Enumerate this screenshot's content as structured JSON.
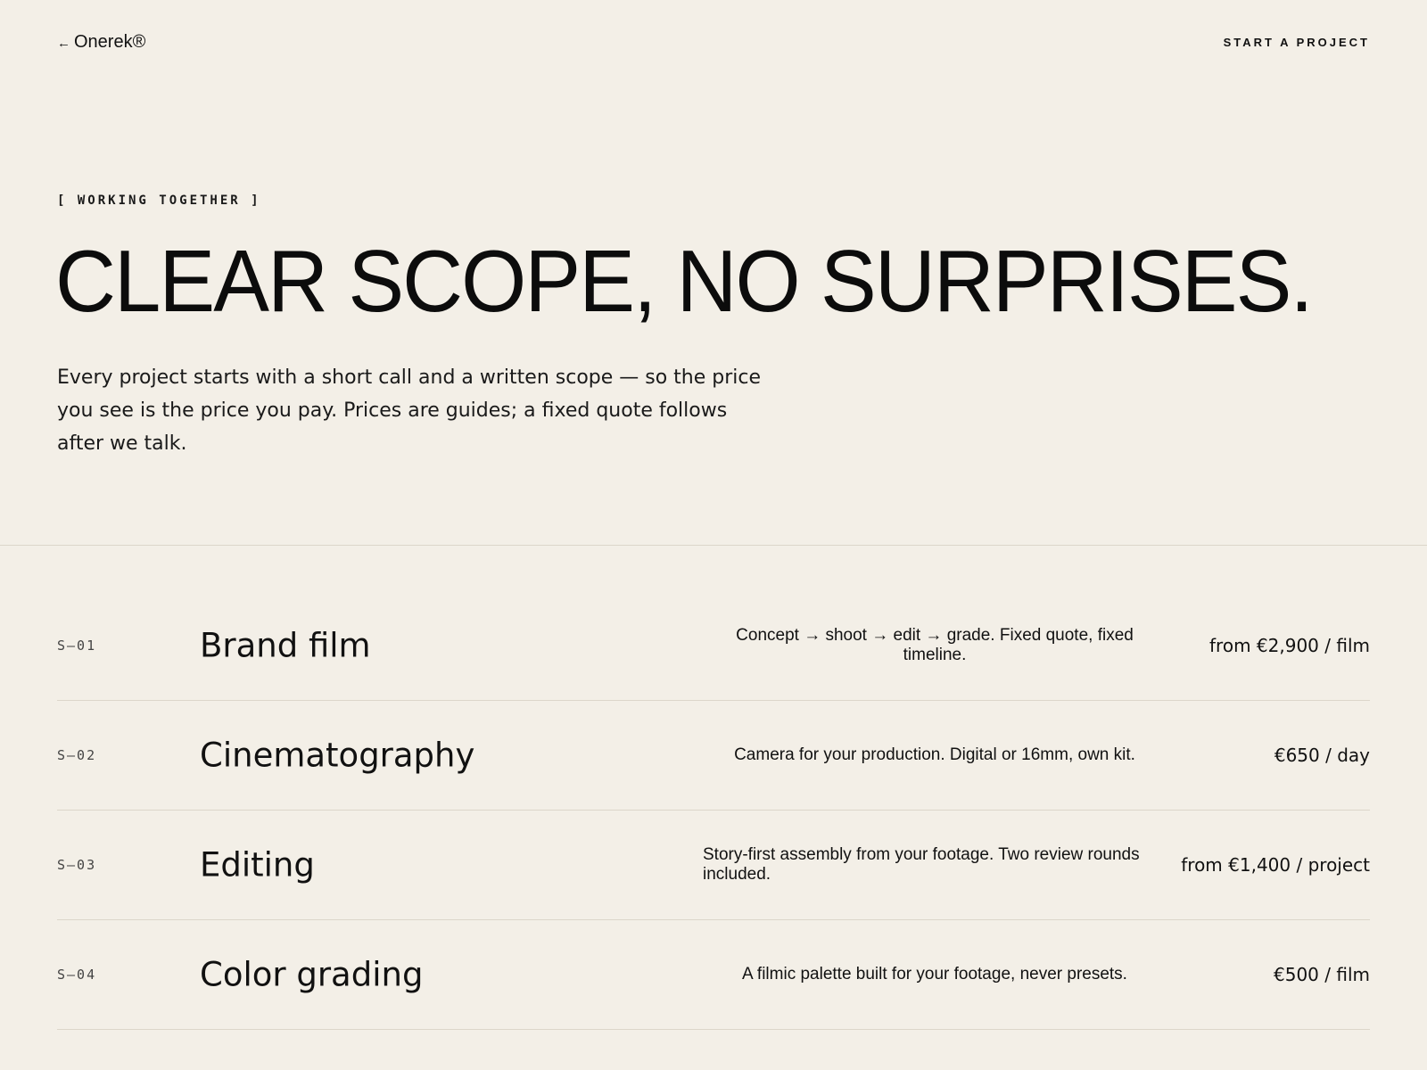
{
  "header": {
    "back_arrow": "←",
    "brand": "Onerek®",
    "cta": "START A PROJECT"
  },
  "hero": {
    "eyebrow": "[ WORKING TOGETHER ]",
    "headline": "CLEAR SCOPE, NO SURPRISES.",
    "intro": "Every project starts with a short call and a written scope — so the price you see is the price you pay. Prices are guides; a fixed quote follows after we talk."
  },
  "services": [
    {
      "code": "S—01",
      "title": "Brand film",
      "description": "Concept → shoot → edit → grade. Fixed quote, fixed timeline.",
      "price": "from €2,900 / film"
    },
    {
      "code": "S—02",
      "title": "Cinematography",
      "description": "Camera for your production. Digital or 16mm, own kit.",
      "price": "€650 / day"
    },
    {
      "code": "S—03",
      "title": "Editing",
      "description": "Story-first assembly from your footage. Two review rounds included.",
      "price": "from €1,400 / project"
    },
    {
      "code": "S—04",
      "title": "Color grading",
      "description": "A filmic palette built for your footage, never presets.",
      "price": "€500 / film"
    }
  ],
  "colors": {
    "background": "#f3efe7",
    "text": "#111111",
    "rule": "#dcd6ca"
  }
}
